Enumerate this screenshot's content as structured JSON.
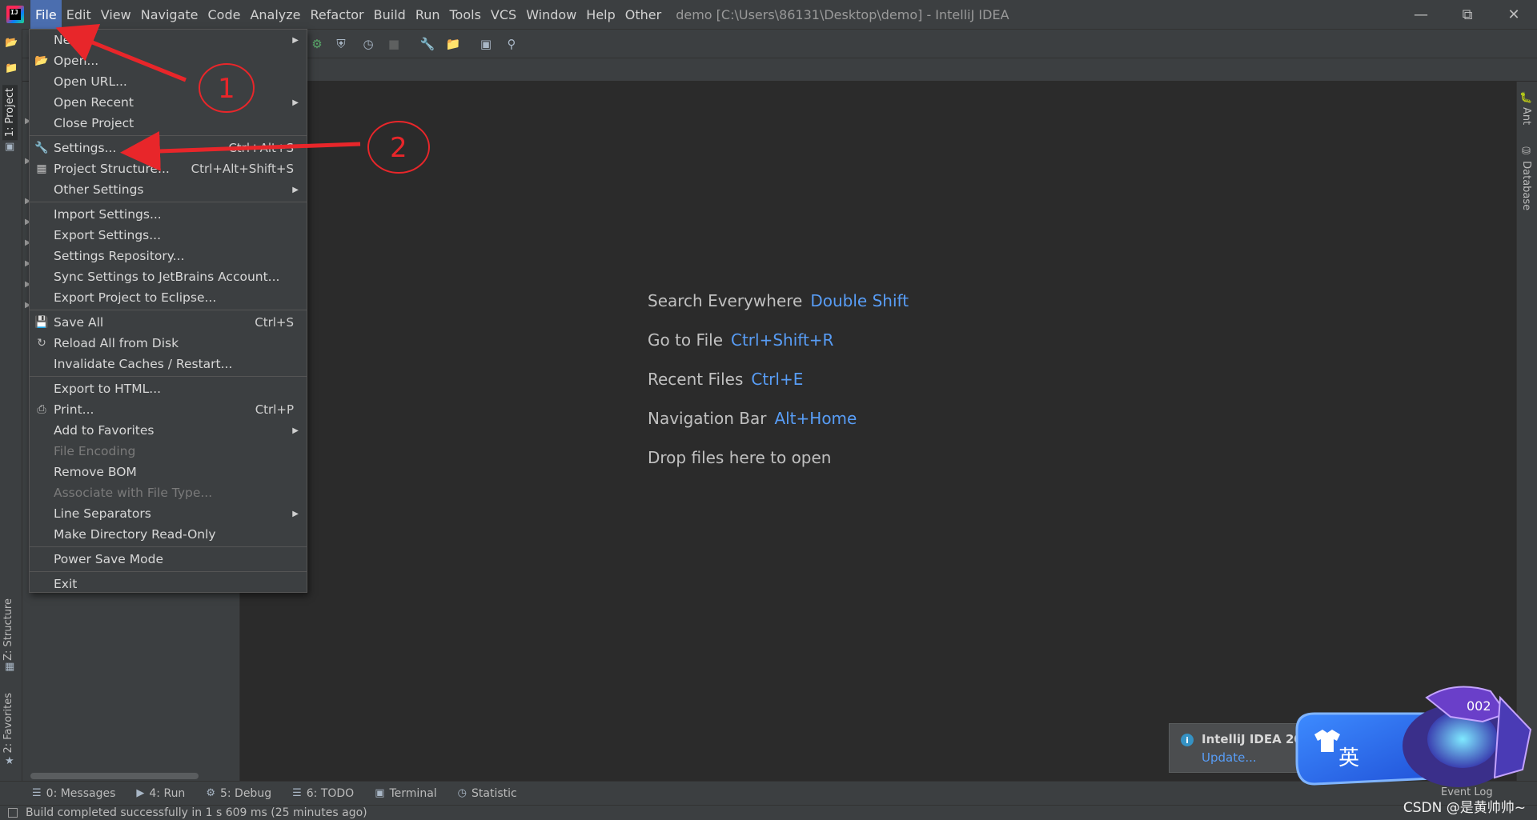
{
  "window": {
    "title": "demo [C:\\Users\\86131\\Desktop\\demo] - IntelliJ IDEA",
    "logo_text": "IJ"
  },
  "menubar": {
    "items": [
      "File",
      "Edit",
      "View",
      "Navigate",
      "Code",
      "Analyze",
      "Refactor",
      "Build",
      "Run",
      "Tools",
      "VCS",
      "Window",
      "Help",
      "Other"
    ]
  },
  "file_menu": {
    "items": [
      {
        "label": "New",
        "shortcut": "",
        "submenu": true
      },
      {
        "label": "Open...",
        "shortcut": "",
        "icon": "folder-open-icon"
      },
      {
        "label": "Open URL...",
        "shortcut": ""
      },
      {
        "label": "Open Recent",
        "shortcut": "",
        "submenu": true
      },
      {
        "label": "Close Project",
        "shortcut": ""
      },
      {
        "label": "Settings...",
        "shortcut": "Ctrl+Alt+S",
        "icon": "wrench-icon"
      },
      {
        "label": "Project Structure...",
        "shortcut": "Ctrl+Alt+Shift+S",
        "icon": "project-structure-icon"
      },
      {
        "label": "Other Settings",
        "shortcut": "",
        "submenu": true
      },
      {
        "label": "Import Settings...",
        "shortcut": ""
      },
      {
        "label": "Export Settings...",
        "shortcut": ""
      },
      {
        "label": "Settings Repository...",
        "shortcut": ""
      },
      {
        "label": "Sync Settings to JetBrains Account...",
        "shortcut": ""
      },
      {
        "label": "Export Project to Eclipse...",
        "shortcut": ""
      },
      {
        "label": "Save All",
        "shortcut": "Ctrl+S",
        "icon": "save-icon"
      },
      {
        "label": "Reload All from Disk",
        "shortcut": "",
        "icon": "reload-icon"
      },
      {
        "label": "Invalidate Caches / Restart...",
        "shortcut": ""
      },
      {
        "label": "Export to HTML...",
        "shortcut": ""
      },
      {
        "label": "Print...",
        "shortcut": "Ctrl+P",
        "icon": "print-icon"
      },
      {
        "label": "Add to Favorites",
        "shortcut": "",
        "submenu": true
      },
      {
        "label": "File Encoding",
        "shortcut": "",
        "disabled": true
      },
      {
        "label": "Remove BOM",
        "shortcut": ""
      },
      {
        "label": "Associate with File Type...",
        "shortcut": "",
        "disabled": true
      },
      {
        "label": "Line Separators",
        "shortcut": "",
        "submenu": true
      },
      {
        "label": "Make Directory Read-Only",
        "shortcut": ""
      },
      {
        "label": "Power Save Mode",
        "shortcut": ""
      },
      {
        "label": "Exit",
        "shortcut": ""
      }
    ]
  },
  "left_stripe": {
    "project_tab": "1: Project",
    "structure_tab": "Z: Structure",
    "favorites_tab": "2: Favorites"
  },
  "right_stripe": {
    "ant_tab": "Ant",
    "database_tab": "Database"
  },
  "editor_hints": [
    {
      "text": "Search Everywhere",
      "key": "Double Shift"
    },
    {
      "text": "Go to File",
      "key": "Ctrl+Shift+R"
    },
    {
      "text": "Recent Files",
      "key": "Ctrl+E"
    },
    {
      "text": "Navigation Bar",
      "key": "Alt+Home"
    },
    {
      "text": "Drop files here to open",
      "key": ""
    }
  ],
  "bottom_tabs": [
    {
      "label": "0: Messages",
      "icon": "messages-icon"
    },
    {
      "label": "4: Run",
      "icon": "run-icon"
    },
    {
      "label": "5: Debug",
      "icon": "debug-icon"
    },
    {
      "label": "6: TODO",
      "icon": "todo-icon"
    },
    {
      "label": "Terminal",
      "icon": "terminal-icon"
    },
    {
      "label": "Statistic",
      "icon": "statistic-icon"
    }
  ],
  "status": {
    "message": "Build completed successfully in 1 s 609 ms (25 minutes ago)",
    "event_log": "Event Log"
  },
  "notification": {
    "title": "IntelliJ IDEA 202",
    "link": "Update..."
  },
  "annotations": {
    "step1": "1",
    "step2": "2"
  },
  "ime_widget": {
    "label": "英",
    "badge": "002"
  },
  "watermark": "CSDN @是黄帅帅~",
  "colors": {
    "accent": "#4b6eaf",
    "link": "#589df6",
    "annotation_red": "#e8262a"
  }
}
